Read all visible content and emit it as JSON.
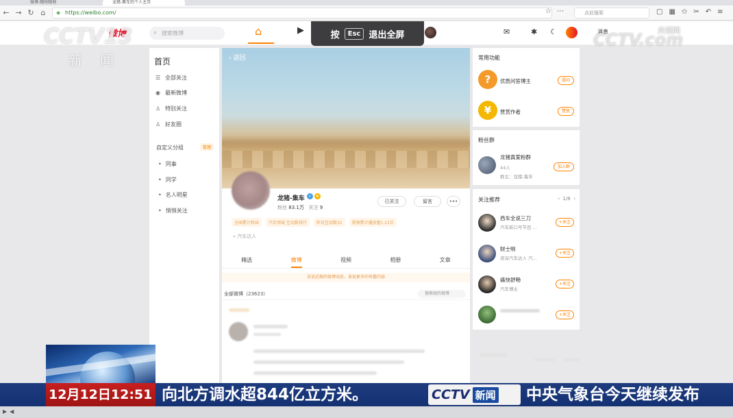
{
  "browser": {
    "tabs": [
      "微博-随时随地",
      "龙猪-集车的个人主页"
    ],
    "url": "https://weibo.com/",
    "search_placeholder": "点此搜索"
  },
  "header": {
    "logo_text": "微博",
    "search_placeholder": "搜索微博",
    "write_label": "消息"
  },
  "fullscreen_toast": {
    "prefix": "按",
    "key": "Esc",
    "suffix": "退出全屏"
  },
  "leftnav": {
    "title": "首页",
    "items": [
      {
        "icon": "☰",
        "label": "全部关注"
      },
      {
        "icon": "◉",
        "label": "最新微博"
      },
      {
        "icon": "♙",
        "label": "特别关注"
      },
      {
        "icon": "♙",
        "label": "好友圈"
      }
    ],
    "group_title": "自定义分组",
    "group_manage": "管理",
    "groups": [
      "同事",
      "同学",
      "名人明星",
      "悄悄关注"
    ]
  },
  "profile": {
    "back_label": "返回",
    "name": "龙猪-集车",
    "fans_label": "粉丝",
    "fans": "83.1万",
    "follow_label": "关注",
    "follow": "9",
    "followed_btn": "已关注",
    "message_btn": "留言",
    "more_btn": "•••",
    "tags": [
      "全国累计粉丝",
      "汽车领域 互动数排行",
      "昨日互动数32",
      "视频累计播放量1.21亿"
    ],
    "location": "汽车达人",
    "tabs": [
      "精选",
      "微博",
      "视频",
      "相册",
      "文章"
    ],
    "active_tab": 1,
    "notice": "说说近期的微博动态，发现更多的有趣内容",
    "all_label": "全部微博（23623）",
    "search_label": "搜索她的微博"
  },
  "right": {
    "common_title": "常用功能",
    "common": [
      {
        "label": "优质问答博主",
        "btn": "提问",
        "color": "#f39a2a",
        "icon": "?"
      },
      {
        "label": "赞赏作者",
        "btn": "赞赏",
        "color": "#f5b800",
        "icon": "¥"
      }
    ],
    "fans_title": "粉丝群",
    "fans_group": {
      "name": "龙猪真爱粉群",
      "count": "44人",
      "owner": "群主：龙猪-集车",
      "btn": "加入群"
    },
    "rec_title": "关注推荐",
    "rec_pager": "1/8",
    "rec_follow_label": "+关注",
    "recs": [
      {
        "name": "西车全说三刀",
        "sub": "汽车新口号节目 ..."
      },
      {
        "name": "财士明",
        "sub": "资深汽车达人 汽..."
      },
      {
        "name": "痛快舒畅",
        "sub": "汽车博主"
      },
      {
        "name": "",
        "sub": ""
      }
    ]
  },
  "watermarks": {
    "left_logo": "CCTV13",
    "left_sub": "新闻",
    "right_logo": "CCTV.com",
    "right_sub": "央视网"
  },
  "news": {
    "time": "12月12日12:51",
    "text": "向北方调水超844亿立方米。",
    "logo_cc": "CCTV",
    "logo_xw": "新闻",
    "text2": "中央气象台今天继续发布"
  }
}
